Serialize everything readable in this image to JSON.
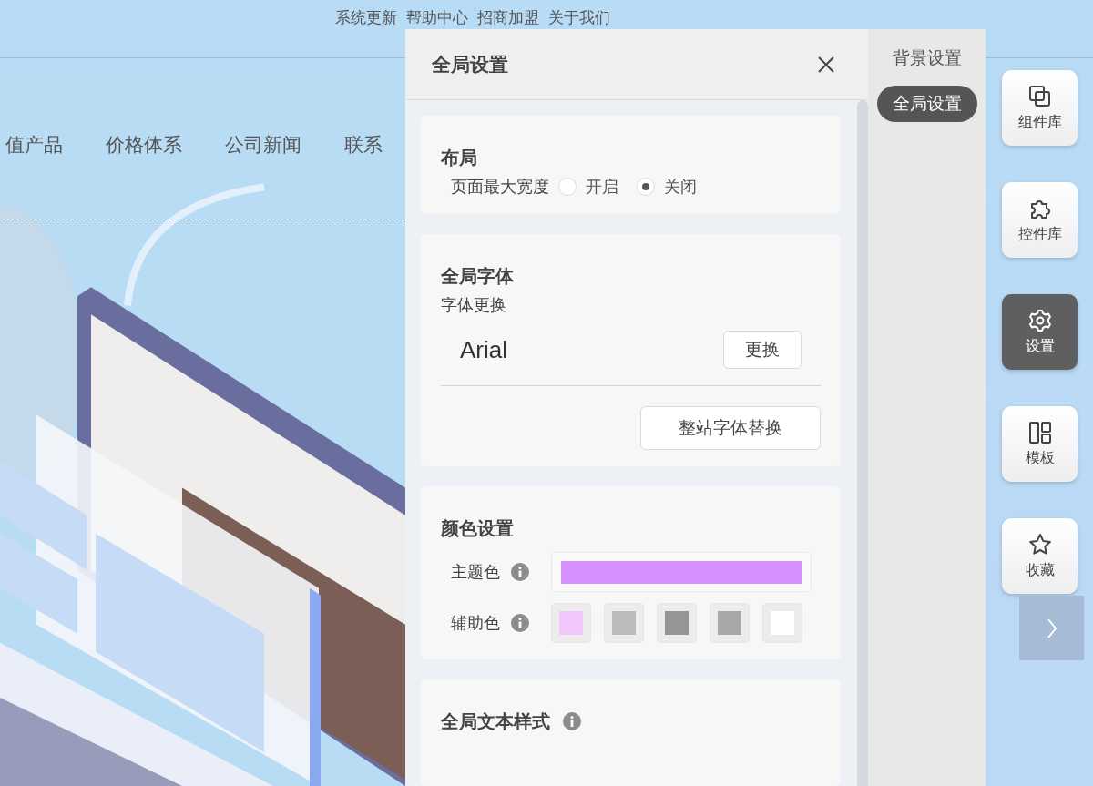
{
  "top_links": [
    {
      "label": "系统更新"
    },
    {
      "label": "帮助中心"
    },
    {
      "label": "招商加盟"
    },
    {
      "label": "关于我们"
    }
  ],
  "nav": [
    {
      "label": "值产品"
    },
    {
      "label": "价格体系"
    },
    {
      "label": "公司新闻"
    },
    {
      "label": "联系"
    }
  ],
  "panel": {
    "title": "全局设置",
    "layout": {
      "title": "布局",
      "option_label": "页面最大宽度",
      "options": [
        {
          "label": "开启",
          "selected": false
        },
        {
          "label": "关闭",
          "selected": true
        }
      ]
    },
    "font": {
      "title": "全局字体",
      "subtitle": "字体更换",
      "current_font": "Arial",
      "change_button": "更换",
      "replace_all_button": "整站字体替换"
    },
    "colors": {
      "title": "颜色设置",
      "theme_label": "主题色",
      "theme": {
        "color": "#d58ffe"
      },
      "secondary_label": "辅助色",
      "swatches": [
        {
          "color": "#f1c6fd"
        },
        {
          "color": "#bcbcbc"
        },
        {
          "color": "#959595"
        },
        {
          "color": "#a7a7a7"
        },
        {
          "color": "#ffffff"
        }
      ]
    },
    "text_style": {
      "title": "全局文本样式"
    }
  },
  "panel_tabs": [
    {
      "label": "背景设置",
      "selected": false
    },
    {
      "label": "全局设置",
      "selected": true
    }
  ],
  "toolbar": [
    {
      "label": "组件库",
      "kind": "layers",
      "selected": false
    },
    {
      "label": "控件库",
      "kind": "puzzle",
      "selected": false
    },
    {
      "label": "设置",
      "kind": "gear",
      "selected": true
    },
    {
      "label": "模板",
      "kind": "layout",
      "selected": false
    },
    {
      "label": "收藏",
      "kind": "star",
      "selected": false
    }
  ]
}
